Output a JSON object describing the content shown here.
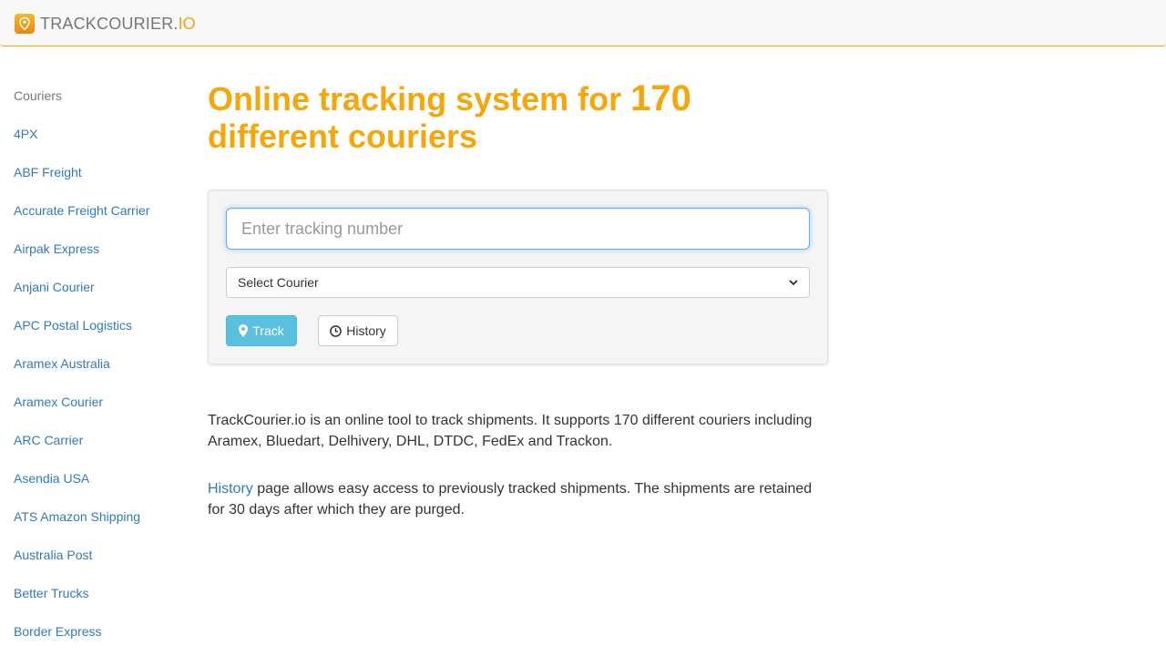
{
  "header": {
    "brand_main": "TRACKCOURIER.",
    "brand_accent": "IO",
    "logo_icon": "map-pin-icon",
    "accent_color": "#f0a30a"
  },
  "sidebar": {
    "heading": "Couriers",
    "items": [
      {
        "label": "4PX"
      },
      {
        "label": "ABF Freight"
      },
      {
        "label": "Accurate Freight Carrier"
      },
      {
        "label": "Airpak Express"
      },
      {
        "label": "Anjani Courier"
      },
      {
        "label": "APC Postal Logistics"
      },
      {
        "label": "Aramex Australia"
      },
      {
        "label": "Aramex Courier"
      },
      {
        "label": "ARC Carrier"
      },
      {
        "label": "Asendia USA"
      },
      {
        "label": "ATS Amazon Shipping"
      },
      {
        "label": "Australia Post"
      },
      {
        "label": "Better Trucks"
      },
      {
        "label": "Border Express"
      }
    ]
  },
  "main": {
    "title_part1": "Online tracking system for ",
    "title_number": "170",
    "title_part2": " different couriers",
    "title_color": "#f5a60b",
    "form": {
      "tracking_placeholder": "Enter tracking number",
      "tracking_value": "",
      "courier_selected": "Select Courier",
      "track_button_label": "Track",
      "track_icon": "map-marker-icon",
      "history_button_label": "History",
      "history_icon": "clock-icon"
    },
    "description": "TrackCourier.io is an online tool to track shipments. It supports 170 different couriers including Aramex, Bluedart, Delhivery, DHL, DTDC, FedEx and Trackon.",
    "history_link": "History",
    "history_text": " page allows easy access to previously tracked shipments. The shipments are retained for 30 days after which they are purged."
  }
}
